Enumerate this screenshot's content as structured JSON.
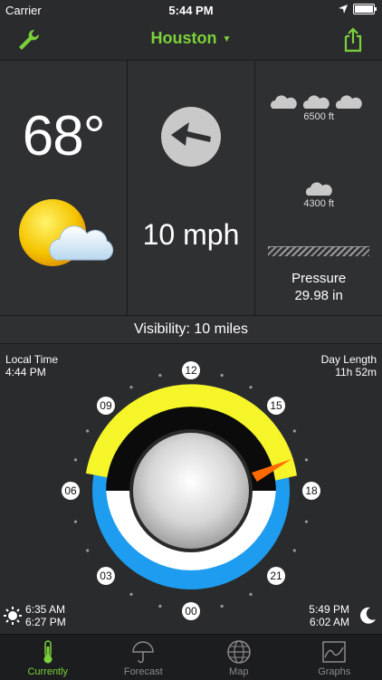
{
  "status_bar": {
    "carrier": "Carrier",
    "time": "5:44 PM"
  },
  "header": {
    "location": "Houston",
    "wrench_icon": "wrench-icon",
    "share_icon": "share-icon"
  },
  "current": {
    "temperature": "68°",
    "condition_icon": "partly-cloudy-icon",
    "wind_speed": "10 mph",
    "wind_icon": "wind-direction-arrow-icon",
    "clouds": [
      {
        "label": "6500 ft",
        "count": 3
      },
      {
        "label": "4300 ft",
        "count": 1
      }
    ],
    "pressure_label": "Pressure",
    "pressure_value": "29.98 in",
    "visibility": "Visibility:  10 miles"
  },
  "clock": {
    "local_time_label": "Local Time",
    "local_time": "4:44 PM",
    "day_length_label": "Day Length",
    "day_length": "11h 52m",
    "sunrise": "6:35 AM",
    "sunset": "6:27 PM",
    "moonrise": "5:49 PM",
    "moonset": "6:02 AM",
    "hour_labels": [
      "12",
      "15",
      "18",
      "21",
      "00",
      "03",
      "06",
      "09"
    ],
    "colors": {
      "day": "#f5f52a",
      "night": "#1e9cf0",
      "hand": "#ff6a00"
    }
  },
  "tabs": [
    {
      "label": "Currently",
      "icon": "thermometer-icon",
      "active": true
    },
    {
      "label": "Forecast",
      "icon": "umbrella-icon",
      "active": false
    },
    {
      "label": "Map",
      "icon": "globe-icon",
      "active": false
    },
    {
      "label": "Graphs",
      "icon": "graph-icon",
      "active": false
    }
  ]
}
